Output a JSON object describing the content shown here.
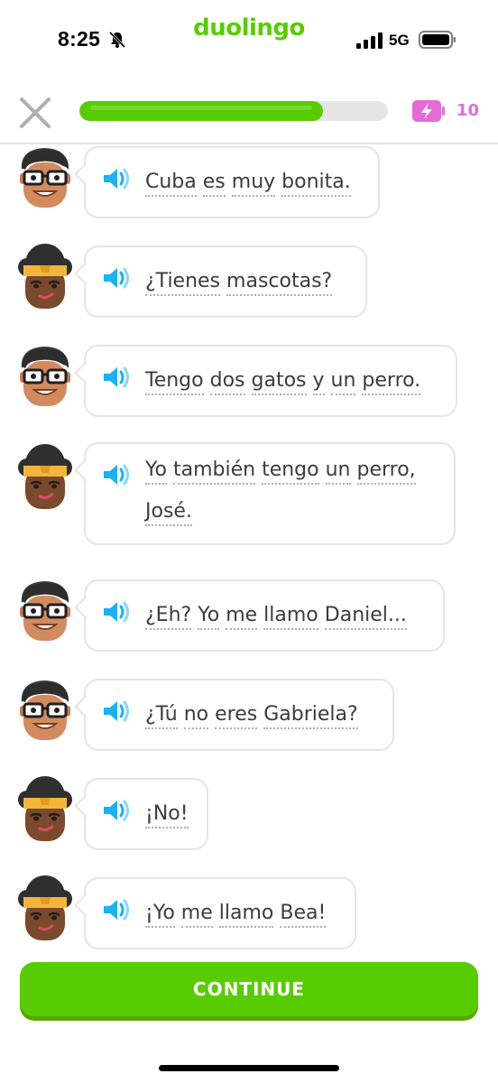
{
  "status_bar": {
    "time": "8:25",
    "network": "5G",
    "icons": [
      "bell-off-icon",
      "signal-icon",
      "battery-icon"
    ]
  },
  "brand": "duolingo",
  "lesson": {
    "progress_fraction": 0.79,
    "energy_count": "10",
    "accent_color": "#58cc02",
    "energy_color": "#e56bd6"
  },
  "messages": [
    {
      "speaker": "jose",
      "text": "Cuba es muy bonita."
    },
    {
      "speaker": "bea",
      "text": "¿Tienes mascotas?"
    },
    {
      "speaker": "jose",
      "text": "Tengo dos gatos y un perro."
    },
    {
      "speaker": "bea",
      "text": "Yo también tengo un perro, José."
    },
    {
      "speaker": "jose",
      "text": "¿Eh? Yo me llamo Daniel..."
    },
    {
      "speaker": "jose",
      "text": "¿Tú no eres Gabriela?"
    },
    {
      "speaker": "bea",
      "text": "¡No!"
    },
    {
      "speaker": "bea",
      "text": "¡Yo me llamo Bea!"
    }
  ],
  "continue_label": "CONTINUE"
}
